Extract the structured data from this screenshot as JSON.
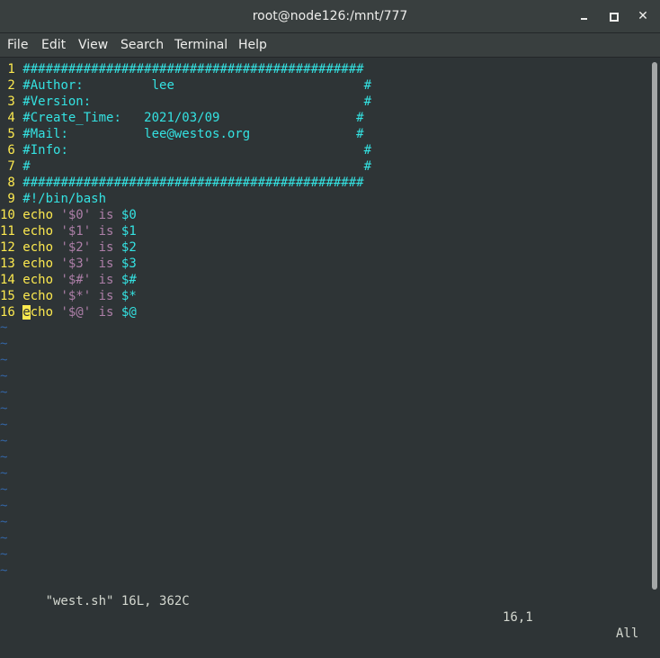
{
  "window": {
    "title": "root@node126:/mnt/777",
    "minimize_icon": "minimize-icon",
    "maximize_icon": "maximize-icon",
    "close_icon": "close-icon",
    "close_glyph": "✕"
  },
  "menu": {
    "items": [
      "File",
      "Edit",
      "View",
      "Search",
      "Terminal",
      "Help"
    ]
  },
  "editor": {
    "lines": [
      {
        "n": " 1",
        "segs": [
          [
            "cy",
            "#############################################"
          ]
        ]
      },
      {
        "n": " 2",
        "segs": [
          [
            "cy",
            "#Author:         lee                         #"
          ]
        ]
      },
      {
        "n": " 3",
        "segs": [
          [
            "cy",
            "#Version:                                    #"
          ]
        ]
      },
      {
        "n": " 4",
        "segs": [
          [
            "cy",
            "#Create_Time:   2021/03/09                  #"
          ]
        ]
      },
      {
        "n": " 5",
        "segs": [
          [
            "cy",
            "#Mail:          lee@westos.org              #"
          ]
        ]
      },
      {
        "n": " 6",
        "segs": [
          [
            "cy",
            "#Info:                                       #"
          ]
        ]
      },
      {
        "n": " 7",
        "segs": [
          [
            "cy",
            "#                                            #"
          ]
        ]
      },
      {
        "n": " 8",
        "segs": [
          [
            "cy",
            "#############################################"
          ]
        ]
      },
      {
        "n": " 9",
        "segs": [
          [
            "cy",
            "#!/bin/bash"
          ]
        ]
      },
      {
        "n": "10",
        "segs": [
          [
            "ye",
            "echo "
          ],
          [
            "pu",
            "'$0' is "
          ],
          [
            "cy",
            "$0"
          ]
        ]
      },
      {
        "n": "11",
        "segs": [
          [
            "ye",
            "echo "
          ],
          [
            "pu",
            "'$1' is "
          ],
          [
            "cy",
            "$1"
          ]
        ]
      },
      {
        "n": "12",
        "segs": [
          [
            "ye",
            "echo "
          ],
          [
            "pu",
            "'$2' is "
          ],
          [
            "cy",
            "$2"
          ]
        ]
      },
      {
        "n": "13",
        "segs": [
          [
            "ye",
            "echo "
          ],
          [
            "pu",
            "'$3' is "
          ],
          [
            "cy",
            "$3"
          ]
        ]
      },
      {
        "n": "14",
        "segs": [
          [
            "ye",
            "echo "
          ],
          [
            "pu",
            "'$#' is "
          ],
          [
            "cy",
            "$#"
          ]
        ]
      },
      {
        "n": "15",
        "segs": [
          [
            "ye",
            "echo "
          ],
          [
            "pu",
            "'$*' is "
          ],
          [
            "cy",
            "$*"
          ]
        ]
      },
      {
        "n": "16",
        "segs": [
          [
            "cursor",
            "e"
          ],
          [
            "ye",
            "cho "
          ],
          [
            "pu",
            "'$@' is "
          ],
          [
            "cy",
            "$@"
          ]
        ]
      }
    ],
    "tilde": "~",
    "tilde_count": 16
  },
  "status": {
    "file": "\"west.sh\" 16L, 362C",
    "position": "16,1",
    "scroll": "All"
  },
  "colors": {
    "background": "#2e3436",
    "line_number": "#fce94f",
    "comment": "#34e2e2",
    "keyword": "#fce94f",
    "string": "#ad7fa8",
    "tilde": "#3465a4"
  }
}
